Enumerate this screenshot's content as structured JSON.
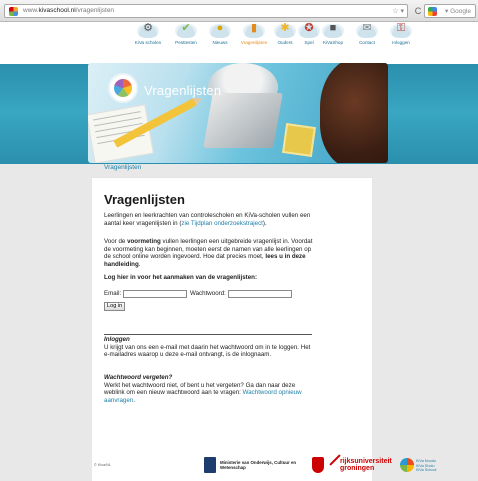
{
  "browser": {
    "url_prefix": "www.",
    "url_host": "kivaschool.nl",
    "url_path": "/vragenlijsten",
    "search_placeholder": "Google"
  },
  "nav": {
    "items": [
      {
        "label": "KiVa scholen",
        "icon": "school-icon"
      },
      {
        "label": "Pesttesten",
        "icon": "check-icon"
      },
      {
        "label": "Nieuws",
        "icon": "news-icon"
      },
      {
        "label": "Vragenlijsten",
        "icon": "questionnaire-icon",
        "active": true
      },
      {
        "label": "Ouders",
        "icon": "parents-icon"
      },
      {
        "label": "Spel",
        "icon": "game-icon"
      },
      {
        "label": "KiVaShop",
        "icon": "shop-icon"
      },
      {
        "label": "Contact",
        "icon": "mail-icon"
      },
      {
        "label": "Inloggen",
        "icon": "login-icon"
      }
    ]
  },
  "banner": {
    "title": "Vragenlijsten"
  },
  "breadcrumb": "Vragenlijsten",
  "content": {
    "heading": "Vragenlijsten",
    "intro_1": "Leerlingen en leerkrachten van controlescholen en KiVa-scholen vullen een aantal keer vragenlijsten in (",
    "intro_link": "zie Tijdplan onderzoekstraject",
    "intro_2": ").",
    "voormeting_1": "Voor de ",
    "voormeting_bold": "voormeting",
    "voormeting_2": " vullen leerlingen een uitgebreide vragenlijst in. Voordat de voormeting kan beginnen, moeten eerst de namen van alle leerlingen op de school online worden ingevoerd. Hoe dat precies moet,",
    "voormeting_3": "lees u in deze handleiding",
    "voormeting_4": ".",
    "login_prompt_1": "Log hier in voor het aanmaken van de ",
    "login_prompt_bold": "vragenlijsten",
    "login_prompt_2": ":",
    "email_label": "Email:",
    "password_label": "Wachtwoord:",
    "login_button": "Log in",
    "inloggen_title": "Inloggen",
    "inloggen_text": "U krijgt van ons een e-mail met daarin het wachtwoord om in te loggen. Het e-mailadres waarop u deze e-mail ontvangt, is de inlognaam.",
    "forgot_title": "Wachtwoord vergeten?",
    "forgot_text": "Werkt het wachtwoord niet, of bent u het vergeten? Ga dan naar deze weblink om een nieuw wachtwoord aan te vragen: ",
    "forgot_link": "Wachtwoord opnieuw aanvragen",
    "forgot_end": "."
  },
  "footer": {
    "small": "© Kiva/NL",
    "ministry_1": "Ministerie van Onderwijs, Cultuur en",
    "ministry_2": "Wetenschap",
    "rug_1": "rijksuniversiteit",
    "rug_2": "groningen",
    "kiva_1": "KiVa Noodu",
    "kiva_2": "KiVa Sholu",
    "kiva_3": "KiVa School"
  },
  "colors": {
    "link": "#1d7fa8",
    "active_nav": "#e38b1c",
    "banner": "#2a8fad",
    "rug_red": "#cc0000"
  }
}
